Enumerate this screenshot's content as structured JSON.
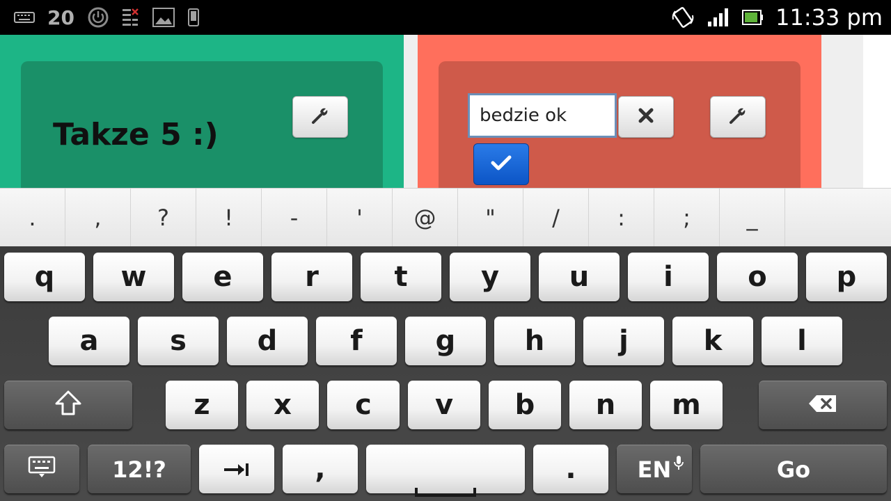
{
  "status_bar": {
    "notification_count": "20",
    "time": "11:33 pm"
  },
  "notes": {
    "left_card": {
      "text": "Takze 5 :)",
      "color": "#1db586"
    },
    "right_card": {
      "input_value": "bedzie ok",
      "color": "#ff6f5c"
    }
  },
  "keyboard": {
    "symbols": [
      ".",
      ",",
      "?",
      "!",
      "-",
      "'",
      "@",
      "\"",
      "/",
      ":",
      ";",
      "_"
    ],
    "row1": [
      "q",
      "w",
      "e",
      "r",
      "t",
      "y",
      "u",
      "i",
      "o",
      "p"
    ],
    "row2": [
      "a",
      "s",
      "d",
      "f",
      "g",
      "h",
      "j",
      "k",
      "l"
    ],
    "row3": [
      "z",
      "x",
      "c",
      "v",
      "b",
      "n",
      "m"
    ],
    "bottom": {
      "numbers_label": "12!?",
      "comma_label": ",",
      "period_label": ".",
      "language_label": "EN",
      "go_label": "Go"
    }
  }
}
